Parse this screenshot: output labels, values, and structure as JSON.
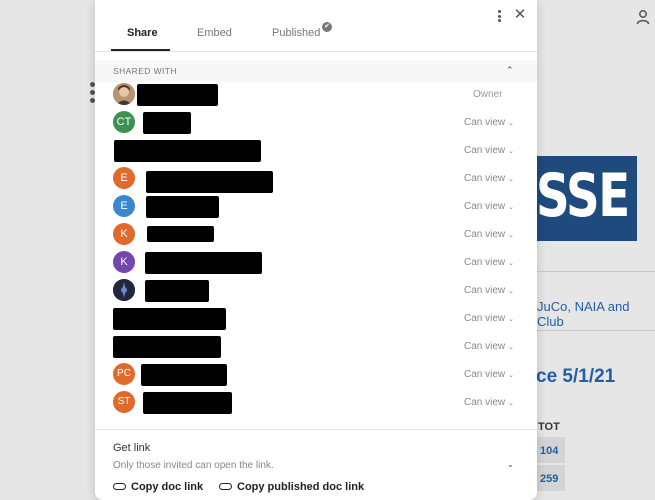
{
  "background": {
    "org_text": "JuCo, NAIA and Club",
    "date_text": "ce 5/1/21",
    "table_header": "TOT",
    "table_values": [
      "104",
      "259"
    ],
    "banner_text": "SSE"
  },
  "modal": {
    "tabs": [
      {
        "label": "Share",
        "active": true
      },
      {
        "label": "Embed",
        "active": false
      },
      {
        "label": "Published",
        "active": false,
        "badge": "check-icon"
      }
    ],
    "check_glyph": "✔",
    "close_glyph": "✕",
    "shared_with_title": "SHARED WITH",
    "collapse_glyph": "⌃",
    "chevron_glyph": "⌄",
    "people": [
      {
        "avatar_type": "photo",
        "initials": "",
        "avatar_color": "#c8a27a",
        "role": "Owner"
      },
      {
        "avatar_type": "initials",
        "initials": "CT",
        "avatar_color": "#3c9150",
        "role": "Can view"
      },
      {
        "avatar_type": "none",
        "initials": "",
        "avatar_color": "",
        "role": "Can view"
      },
      {
        "avatar_type": "initials",
        "initials": "E",
        "avatar_color": "#e06a2b",
        "role": "Can view"
      },
      {
        "avatar_type": "initials",
        "initials": "E",
        "avatar_color": "#3a87cf",
        "role": "Can view"
      },
      {
        "avatar_type": "initials",
        "initials": "K",
        "avatar_color": "#e06a2b",
        "role": "Can view"
      },
      {
        "avatar_type": "initials",
        "initials": "K",
        "avatar_color": "#7446b0",
        "role": "Can view"
      },
      {
        "avatar_type": "photo",
        "initials": "",
        "avatar_color": "#2a3550",
        "role": "Can view"
      },
      {
        "avatar_type": "none",
        "initials": "",
        "avatar_color": "",
        "role": "Can view"
      },
      {
        "avatar_type": "none",
        "initials": "",
        "avatar_color": "",
        "role": "Can view"
      },
      {
        "avatar_type": "initials",
        "initials": "PC",
        "avatar_color": "#e06a2b",
        "role": "Can view"
      },
      {
        "avatar_type": "initials",
        "initials": "ST",
        "avatar_color": "#e06a2b",
        "role": "Can view"
      }
    ],
    "get_link_title": "Get link",
    "get_link_subtitle": "Only those invited can open the link.",
    "copy_doc_link": "Copy doc link",
    "copy_published_link": "Copy published doc link"
  }
}
